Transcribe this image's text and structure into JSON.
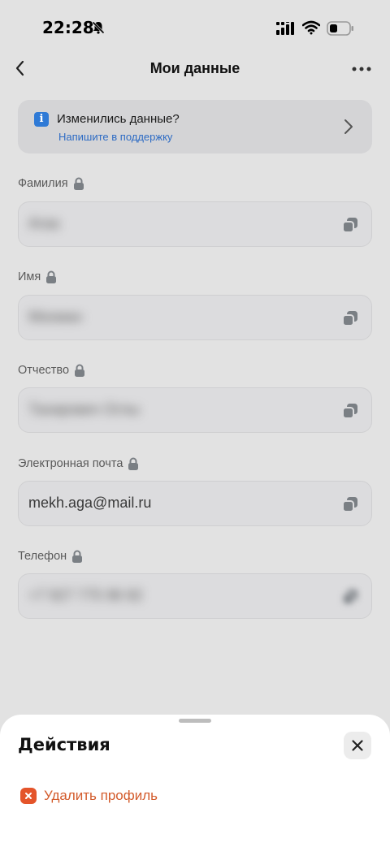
{
  "status_bar": {
    "time": "22:28"
  },
  "header": {
    "title": "Мои данные"
  },
  "info_card": {
    "title": "Изменились данные?",
    "link": "Напишите в поддержку",
    "icon": "info-icon"
  },
  "fields": [
    {
      "label": "Фамилия",
      "value": "Агаа",
      "blurred": true
    },
    {
      "label": "Имя",
      "value": "Мехман",
      "blurred": true
    },
    {
      "label": "Отчество",
      "value": "Тахирович Оглы",
      "blurred": true
    },
    {
      "label": "Электронная почта",
      "value": "mekh.aga@mail.ru",
      "blurred": false
    },
    {
      "label": "Телефон",
      "value": "+7 927 775 96 82",
      "blurred": true
    }
  ],
  "sheet": {
    "title": "Действия",
    "delete_label": "Удалить профиль"
  },
  "colors": {
    "background": "#e2e2e2",
    "accent_blue": "#2f7ad6",
    "danger": "#e4542a"
  }
}
